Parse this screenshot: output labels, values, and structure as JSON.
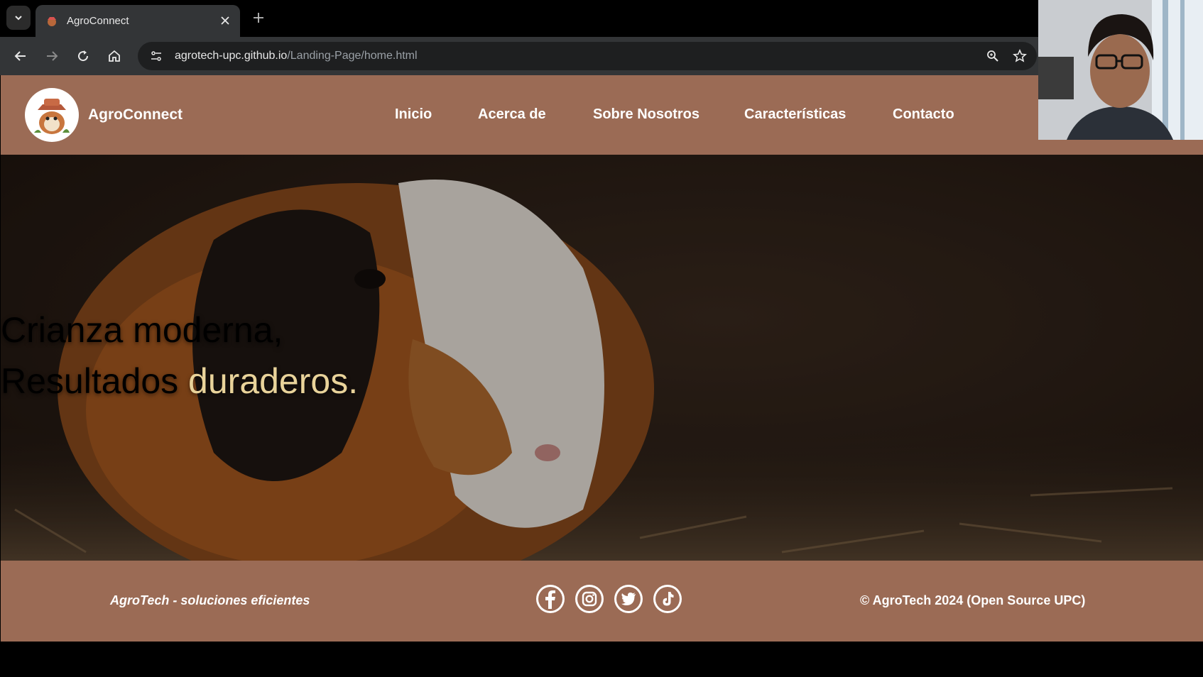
{
  "browser": {
    "tab": {
      "title": "AgroConnect"
    },
    "url": {
      "host": "agrotech-upc.github.io",
      "path": "/Landing-Page/home.html"
    }
  },
  "site": {
    "brand": "AgroConnect",
    "nav": [
      "Inicio",
      "Acerca de",
      "Sobre Nosotros",
      "Características",
      "Contacto"
    ],
    "hero": {
      "line1": "Crianza moderna,",
      "line2_start": "Resultados ",
      "line2_accent": "duraderos."
    },
    "footer": {
      "tagline": "AgroTech - soluciones eficientes",
      "social": [
        "facebook-icon",
        "instagram-icon",
        "twitter-icon",
        "tiktok-icon"
      ],
      "copyright": "© AgroTech 2024 (Open Source UPC)"
    }
  },
  "colors": {
    "header_bg": "#9b6b55",
    "accent_text": "#e9d39a",
    "chrome_bg": "#333537"
  }
}
